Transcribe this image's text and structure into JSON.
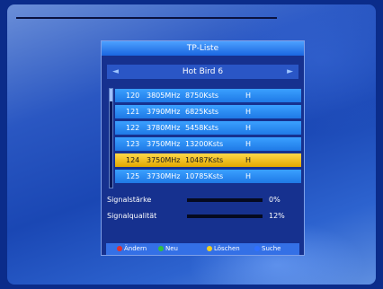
{
  "panel": {
    "title": "TP-Liste",
    "satellite": "Hot Bird 6",
    "left_arrow": "◄",
    "right_arrow": "►"
  },
  "transponders": [
    {
      "no": "120",
      "freq": "3805MHz",
      "sr": "8750Ksts",
      "pol": "H"
    },
    {
      "no": "121",
      "freq": "3790MHz",
      "sr": "6825Ksts",
      "pol": "H"
    },
    {
      "no": "122",
      "freq": "3780MHz",
      "sr": "5458Ksts",
      "pol": "H"
    },
    {
      "no": "123",
      "freq": "3750MHz",
      "sr": "13200Ksts",
      "pol": "H"
    },
    {
      "no": "124",
      "freq": "3750MHz",
      "sr": "10487Ksts",
      "pol": "H"
    },
    {
      "no": "125",
      "freq": "3730MHz",
      "sr": "10785Ksts",
      "pol": "H"
    }
  ],
  "selected_index": 4,
  "meters": {
    "strength_label": "Signalstärke",
    "strength_value": "0%",
    "quality_label": "Signalqualität",
    "quality_value": "12%"
  },
  "footer": {
    "red": {
      "label": "Ändern",
      "color": "#e03030"
    },
    "green": {
      "label": "Neu",
      "color": "#30c040"
    },
    "yellow": {
      "label": "Löschen",
      "color": "#f0d020"
    },
    "blue": {
      "label": "Suche",
      "color": "#3070ff"
    }
  }
}
